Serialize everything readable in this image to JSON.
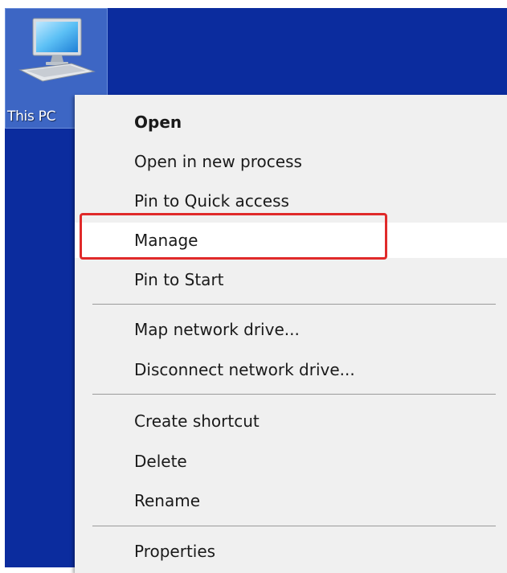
{
  "desktop": {
    "background_color": "#0b2c9e",
    "icon": {
      "label": "This PC",
      "icon_name": "computer-monitor-icon"
    }
  },
  "context_menu": {
    "items": [
      {
        "label": "Open",
        "bold": true
      },
      {
        "label": "Open in new process"
      },
      {
        "label": "Pin to Quick access"
      },
      {
        "label": "Manage",
        "highlighted": true
      },
      {
        "label": "Pin to Start"
      },
      {
        "label": "Map network drive..."
      },
      {
        "label": "Disconnect network drive..."
      },
      {
        "label": "Create shortcut"
      },
      {
        "label": "Delete"
      },
      {
        "label": "Rename"
      },
      {
        "label": "Properties"
      }
    ]
  },
  "annotation": {
    "highlight_color": "#e02a2a",
    "target": "Manage"
  }
}
